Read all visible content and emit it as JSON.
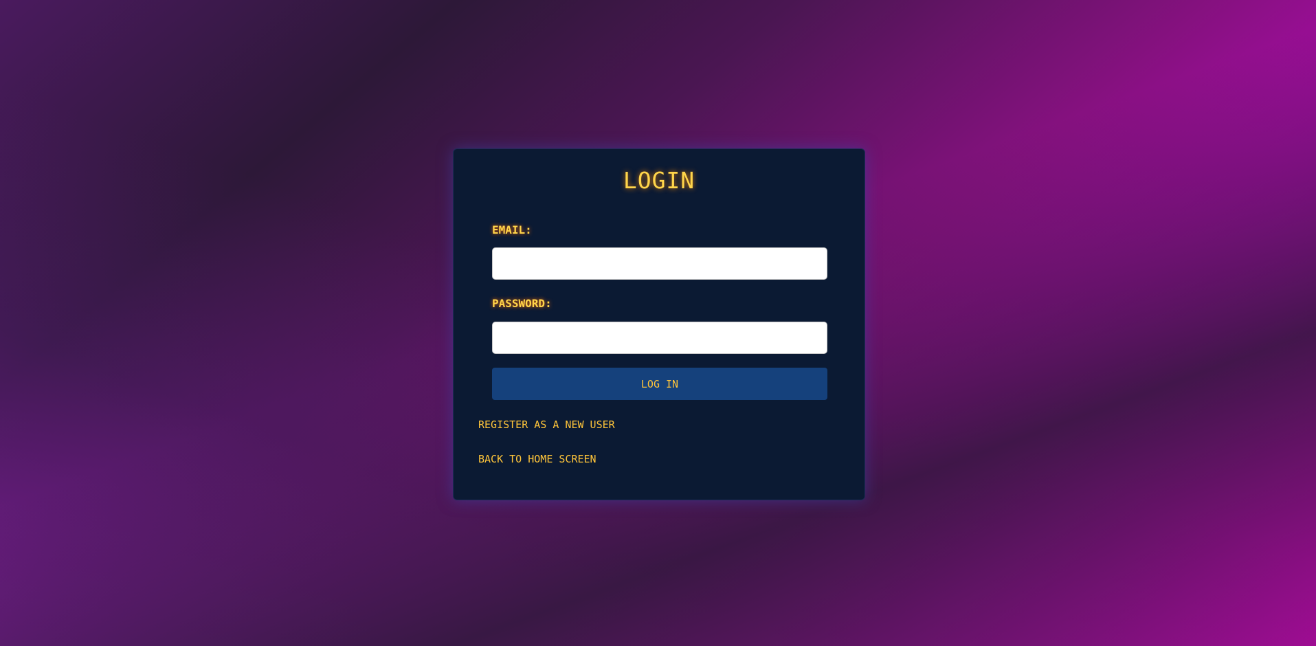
{
  "login": {
    "title": "LOGIN",
    "email_label": "EMAIL:",
    "email_value": "",
    "password_label": "PASSWORD:",
    "password_value": "",
    "submit_label": "LOG IN",
    "register_link": "REGISTER AS A NEW USER",
    "home_link": "BACK TO HOME SCREEN"
  },
  "colors": {
    "card_background": "#0b1a33",
    "accent_text": "#ffd54a",
    "button_background": "#15417c",
    "page_gradient_start": "#4a1a5e",
    "page_gradient_end": "#e800d6"
  }
}
